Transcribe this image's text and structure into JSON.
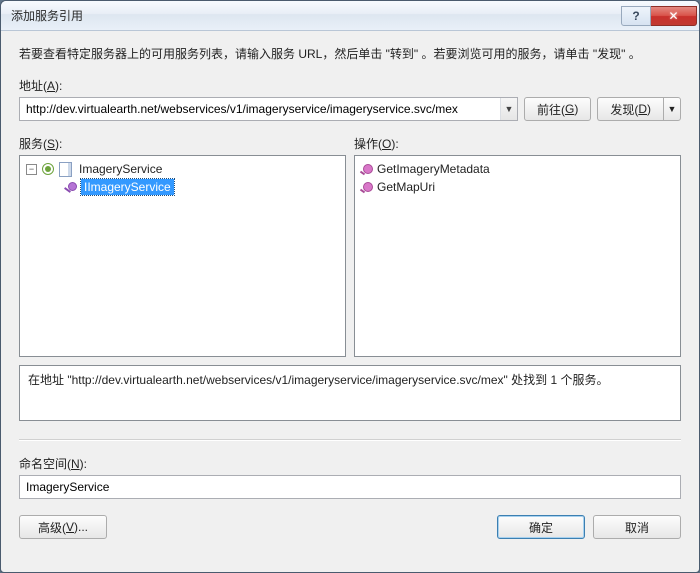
{
  "titlebar": {
    "title": "添加服务引用",
    "help_label": "?",
    "close_label": "✕"
  },
  "instruction": "若要查看特定服务器上的可用服务列表，请输入服务 URL，然后单击 \"转到\" 。若要浏览可用的服务，请单击 \"发现\" 。",
  "address": {
    "label_prefix": "地址(",
    "label_key": "A",
    "label_suffix": "):",
    "value": "http://dev.virtualearth.net/webservices/v1/imageryservice/imageryservice.svc/mex"
  },
  "go_button": {
    "prefix": "前往(",
    "key": "G",
    "suffix": ")"
  },
  "discover_button": {
    "prefix": "发现(",
    "key": "D",
    "suffix": ")"
  },
  "services": {
    "label_prefix": "服务(",
    "label_key": "S",
    "label_suffix": "):",
    "root": "ImageryService",
    "contract": "IImageryService"
  },
  "operations": {
    "label_prefix": "操作(",
    "label_key": "O",
    "label_suffix": "):",
    "items": [
      "GetImageryMetadata",
      "GetMapUri"
    ]
  },
  "status": "在地址 \"http://dev.virtualearth.net/webservices/v1/imageryservice/imageryservice.svc/mex\" 处找到 1 个服务。",
  "namespace": {
    "label_prefix": "命名空间(",
    "label_key": "N",
    "label_suffix": "):",
    "value": "ImageryService"
  },
  "advanced_button": {
    "prefix": "高级(",
    "key": "V",
    "suffix": ")..."
  },
  "ok_button": "确定",
  "cancel_button": "取消"
}
